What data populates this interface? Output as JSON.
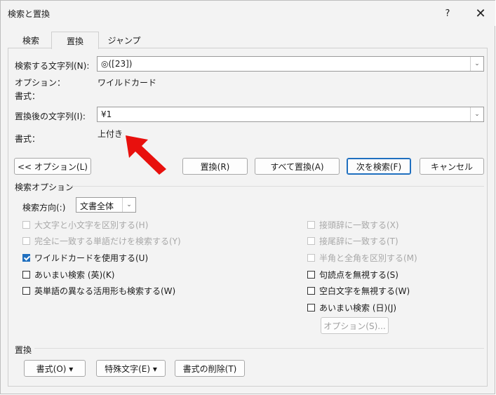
{
  "window": {
    "title": "検索と置換",
    "help": "?",
    "close": "✕"
  },
  "tabs": [
    {
      "label": "検索"
    },
    {
      "label": "置換"
    },
    {
      "label": "ジャンプ"
    }
  ],
  "find": {
    "label": "検索する文字列(N):",
    "value": "◎([23])",
    "options_label": "オプション：",
    "options_value": "ワイルドカード",
    "format_label": "書式："
  },
  "replace": {
    "label": "置換後の文字列(I):",
    "value": "¥1",
    "format_label": "書式：",
    "format_value": "上付き"
  },
  "buttons": {
    "options": "<< オプション(L)",
    "replace": "置換(R)",
    "replace_all": "すべて置換(A)",
    "find_next": "次を検索(F)",
    "cancel": "キャンセル"
  },
  "search_options": {
    "section_label": "検索オプション",
    "direction_label": "検索方向(:)",
    "direction_value": "文書全体",
    "left": [
      {
        "label": "大文字と小文字を区別する(H)",
        "checked": false,
        "disabled": true
      },
      {
        "label": "完全に一致する単語だけを検索する(Y)",
        "checked": false,
        "disabled": true
      },
      {
        "label": "ワイルドカードを使用する(U)",
        "checked": true,
        "disabled": false
      },
      {
        "label": "あいまい検索 (英)(K)",
        "checked": false,
        "disabled": false
      },
      {
        "label": "英単語の異なる活用形も検索する(W)",
        "checked": false,
        "disabled": false
      }
    ],
    "right": [
      {
        "label": "接頭辞に一致する(X)",
        "checked": false,
        "disabled": true
      },
      {
        "label": "接尾辞に一致する(T)",
        "checked": false,
        "disabled": true
      },
      {
        "label": "半角と全角を区別する(M)",
        "checked": false,
        "disabled": true
      },
      {
        "label": "句読点を無視する(S)",
        "checked": false,
        "disabled": false
      },
      {
        "label": "空白文字を無視する(W)",
        "checked": false,
        "disabled": false
      },
      {
        "label": "あいまい検索 (日)(J)",
        "checked": false,
        "disabled": false
      }
    ],
    "fuzzy_options_button": "オプション(S)..."
  },
  "replace_section": {
    "section_label": "置換",
    "format_button": "書式(O) ▾",
    "special_button": "特殊文字(E) ▾",
    "clear_format_button": "書式の削除(T)"
  },
  "colors": {
    "accent": "#1f6fbf",
    "arrow": "#e8100d"
  }
}
